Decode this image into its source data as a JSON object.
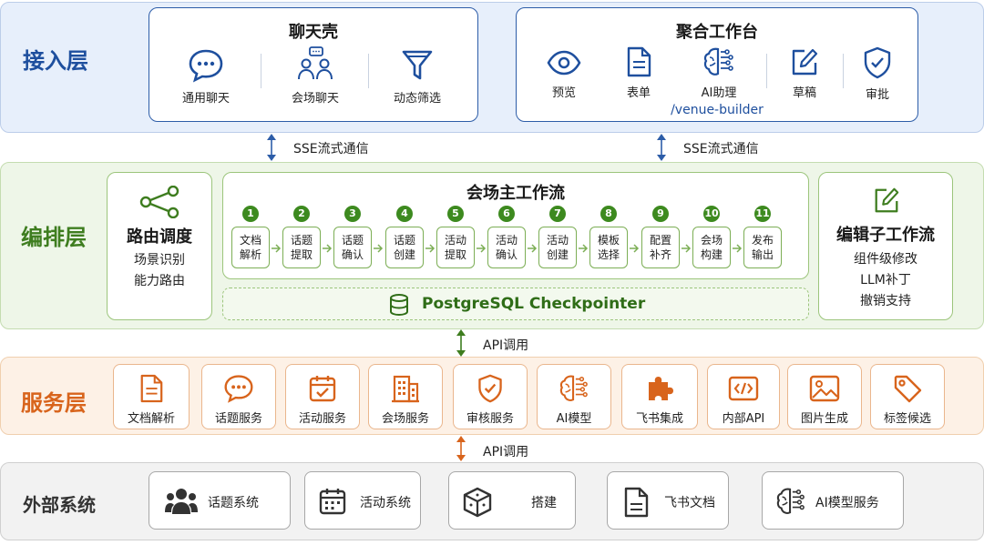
{
  "layers": {
    "access": "接入层",
    "orchestration": "编排层",
    "service": "服务层",
    "external": "外部系统"
  },
  "chat_shell": {
    "title": "聊天壳",
    "items": [
      {
        "label": "通用聊天",
        "icon": "chat-bubble-icon"
      },
      {
        "label": "会场聊天",
        "icon": "people-chat-icon"
      },
      {
        "label": "动态筛选",
        "icon": "filter-icon"
      }
    ]
  },
  "workbench": {
    "title": "聚合工作台",
    "items": [
      {
        "label": "预览",
        "icon": "eye-icon"
      },
      {
        "label": "表单",
        "icon": "document-icon"
      },
      {
        "label": "AI助理",
        "icon": "ai-brain-icon"
      },
      {
        "label": "草稿",
        "icon": "edit-icon"
      },
      {
        "label": "审批",
        "icon": "shield-check-icon"
      }
    ],
    "route": "/venue-builder"
  },
  "connectors": {
    "sse": "SSE流式通信",
    "api": "API调用"
  },
  "router": {
    "title": "路由调度",
    "lines": [
      "场景识别",
      "能力路由"
    ],
    "icon": "share-node-icon"
  },
  "main_workflow": {
    "title": "会场主工作流",
    "steps": [
      {
        "num": "1",
        "line1": "文档",
        "line2": "解析"
      },
      {
        "num": "2",
        "line1": "话题",
        "line2": "提取"
      },
      {
        "num": "3",
        "line1": "话题",
        "line2": "确认"
      },
      {
        "num": "4",
        "line1": "话题",
        "line2": "创建"
      },
      {
        "num": "5",
        "line1": "活动",
        "line2": "提取"
      },
      {
        "num": "6",
        "line1": "活动",
        "line2": "确认"
      },
      {
        "num": "7",
        "line1": "活动",
        "line2": "创建"
      },
      {
        "num": "8",
        "line1": "模板",
        "line2": "选择"
      },
      {
        "num": "9",
        "line1": "配置",
        "line2": "补齐"
      },
      {
        "num": "10",
        "line1": "会场",
        "line2": "构建"
      },
      {
        "num": "11",
        "line1": "发布",
        "line2": "输出"
      }
    ],
    "checkpointer": "PostgreSQL Checkpointer"
  },
  "editor": {
    "title": "编辑子工作流",
    "lines": [
      "组件级修改",
      "LLM补丁",
      "撤销支持"
    ],
    "icon": "edit-icon"
  },
  "services": [
    {
      "label": "文档解析",
      "icon": "document-icon"
    },
    {
      "label": "话题服务",
      "icon": "chat-bubble-icon"
    },
    {
      "label": "活动服务",
      "icon": "calendar-check-icon"
    },
    {
      "label": "会场服务",
      "icon": "building-icon"
    },
    {
      "label": "审核服务",
      "icon": "shield-check-icon"
    },
    {
      "label": "AI模型",
      "icon": "ai-brain-icon"
    },
    {
      "label": "飞书集成",
      "icon": "puzzle-icon"
    },
    {
      "label": "内部API",
      "icon": "code-icon"
    },
    {
      "label": "图片生成",
      "icon": "image-icon"
    },
    {
      "label": "标签候选",
      "icon": "tag-icon"
    }
  ],
  "external": [
    {
      "label": "话题系统",
      "icon": "group-icon"
    },
    {
      "label": "活动系统",
      "icon": "calendar-icon"
    },
    {
      "label": "搭建",
      "icon": "cube-icon"
    },
    {
      "label": "飞书文档",
      "icon": "document-icon"
    },
    {
      "label": "AI模型服务",
      "icon": "ai-brain-icon"
    }
  ],
  "colors": {
    "access": "#1e4f9e",
    "orchestration": "#3e7d1f",
    "service": "#d8641c",
    "external": "#333333"
  }
}
